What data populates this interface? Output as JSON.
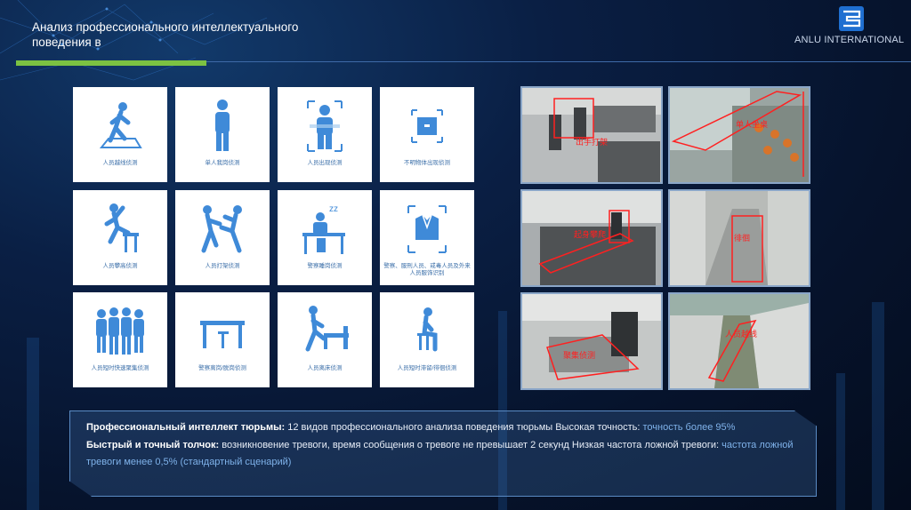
{
  "header": {
    "title": "Анализ профессионального интеллектуального поведения в",
    "logo_icon": "anlu-logo-icon",
    "logo_text": "ANLU INTERNATIONAL",
    "accent_color": "#7cc242"
  },
  "tiles": [
    {
      "icon": "person-crossing-line-icon",
      "label": "人员越线侦测"
    },
    {
      "icon": "person-standing-icon",
      "label": "单人我岗侦测"
    },
    {
      "icon": "person-in-frame-icon",
      "label": "人员出现侦测"
    },
    {
      "icon": "box-object-icon",
      "label": "不明物体出现侦测"
    },
    {
      "icon": "person-climbing-icon",
      "label": "人员攀高侦测"
    },
    {
      "icon": "people-fighting-icon",
      "label": "人员打架侦测"
    },
    {
      "icon": "guard-sleeping-icon",
      "label": "警察睡岗侦测"
    },
    {
      "icon": "clothing-icon",
      "label": "警察、服刑人员、戒毒人员及外来人员服饰识别"
    },
    {
      "icon": "crowd-gathering-icon",
      "label": "人员短时快速聚集侦测"
    },
    {
      "icon": "desk-icon",
      "label": "警察离岗/脱岗侦测"
    },
    {
      "icon": "person-leaving-bed-icon",
      "label": "人员离床侦测"
    },
    {
      "icon": "person-sitting-icon",
      "label": "人员短时滞留/徘徊侦测"
    }
  ],
  "cameras": [
    {
      "name": "camera-feed-1",
      "label": "出手打架"
    },
    {
      "name": "camera-feed-2",
      "label": "单人坐桌"
    },
    {
      "name": "camera-feed-3",
      "label": "起身攀爬"
    },
    {
      "name": "camera-feed-4",
      "label": "徘徊"
    },
    {
      "name": "camera-feed-5",
      "label": "聚集侦测"
    },
    {
      "name": "camera-feed-6",
      "label": "人员越线"
    }
  ],
  "info": {
    "line1_bold": "Профессиональный интеллект тюрьмы:",
    "line1_text": " 12 видов профессионального анализа поведения тюрьмы Высокая точность: ",
    "line1_hl": "точность более 95%",
    "line2_bold": "Быстрый и точный толчок:",
    "line2_text": " возникновение тревоги, время сообщения о тревоге не превышает 2 секунд Низкая частота ложной тревоги: ",
    "line2_hl": "частота ложной",
    "line3_hl": "тревоги менее 0,5% (стандартный сценарий)"
  }
}
